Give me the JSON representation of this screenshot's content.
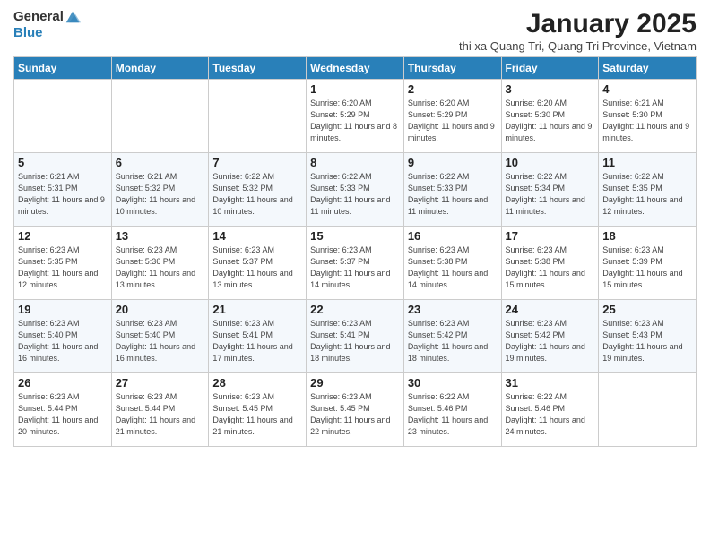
{
  "header": {
    "logo_general": "General",
    "logo_blue": "Blue",
    "title": "January 2025",
    "subtitle": "thi xa Quang Tri, Quang Tri Province, Vietnam"
  },
  "days_of_week": [
    "Sunday",
    "Monday",
    "Tuesday",
    "Wednesday",
    "Thursday",
    "Friday",
    "Saturday"
  ],
  "weeks": [
    [
      {
        "day": "",
        "info": ""
      },
      {
        "day": "",
        "info": ""
      },
      {
        "day": "",
        "info": ""
      },
      {
        "day": "1",
        "info": "Sunrise: 6:20 AM\nSunset: 5:29 PM\nDaylight: 11 hours and 8 minutes."
      },
      {
        "day": "2",
        "info": "Sunrise: 6:20 AM\nSunset: 5:29 PM\nDaylight: 11 hours and 9 minutes."
      },
      {
        "day": "3",
        "info": "Sunrise: 6:20 AM\nSunset: 5:30 PM\nDaylight: 11 hours and 9 minutes."
      },
      {
        "day": "4",
        "info": "Sunrise: 6:21 AM\nSunset: 5:30 PM\nDaylight: 11 hours and 9 minutes."
      }
    ],
    [
      {
        "day": "5",
        "info": "Sunrise: 6:21 AM\nSunset: 5:31 PM\nDaylight: 11 hours and 9 minutes."
      },
      {
        "day": "6",
        "info": "Sunrise: 6:21 AM\nSunset: 5:32 PM\nDaylight: 11 hours and 10 minutes."
      },
      {
        "day": "7",
        "info": "Sunrise: 6:22 AM\nSunset: 5:32 PM\nDaylight: 11 hours and 10 minutes."
      },
      {
        "day": "8",
        "info": "Sunrise: 6:22 AM\nSunset: 5:33 PM\nDaylight: 11 hours and 11 minutes."
      },
      {
        "day": "9",
        "info": "Sunrise: 6:22 AM\nSunset: 5:33 PM\nDaylight: 11 hours and 11 minutes."
      },
      {
        "day": "10",
        "info": "Sunrise: 6:22 AM\nSunset: 5:34 PM\nDaylight: 11 hours and 11 minutes."
      },
      {
        "day": "11",
        "info": "Sunrise: 6:22 AM\nSunset: 5:35 PM\nDaylight: 11 hours and 12 minutes."
      }
    ],
    [
      {
        "day": "12",
        "info": "Sunrise: 6:23 AM\nSunset: 5:35 PM\nDaylight: 11 hours and 12 minutes."
      },
      {
        "day": "13",
        "info": "Sunrise: 6:23 AM\nSunset: 5:36 PM\nDaylight: 11 hours and 13 minutes."
      },
      {
        "day": "14",
        "info": "Sunrise: 6:23 AM\nSunset: 5:37 PM\nDaylight: 11 hours and 13 minutes."
      },
      {
        "day": "15",
        "info": "Sunrise: 6:23 AM\nSunset: 5:37 PM\nDaylight: 11 hours and 14 minutes."
      },
      {
        "day": "16",
        "info": "Sunrise: 6:23 AM\nSunset: 5:38 PM\nDaylight: 11 hours and 14 minutes."
      },
      {
        "day": "17",
        "info": "Sunrise: 6:23 AM\nSunset: 5:38 PM\nDaylight: 11 hours and 15 minutes."
      },
      {
        "day": "18",
        "info": "Sunrise: 6:23 AM\nSunset: 5:39 PM\nDaylight: 11 hours and 15 minutes."
      }
    ],
    [
      {
        "day": "19",
        "info": "Sunrise: 6:23 AM\nSunset: 5:40 PM\nDaylight: 11 hours and 16 minutes."
      },
      {
        "day": "20",
        "info": "Sunrise: 6:23 AM\nSunset: 5:40 PM\nDaylight: 11 hours and 16 minutes."
      },
      {
        "day": "21",
        "info": "Sunrise: 6:23 AM\nSunset: 5:41 PM\nDaylight: 11 hours and 17 minutes."
      },
      {
        "day": "22",
        "info": "Sunrise: 6:23 AM\nSunset: 5:41 PM\nDaylight: 11 hours and 18 minutes."
      },
      {
        "day": "23",
        "info": "Sunrise: 6:23 AM\nSunset: 5:42 PM\nDaylight: 11 hours and 18 minutes."
      },
      {
        "day": "24",
        "info": "Sunrise: 6:23 AM\nSunset: 5:42 PM\nDaylight: 11 hours and 19 minutes."
      },
      {
        "day": "25",
        "info": "Sunrise: 6:23 AM\nSunset: 5:43 PM\nDaylight: 11 hours and 19 minutes."
      }
    ],
    [
      {
        "day": "26",
        "info": "Sunrise: 6:23 AM\nSunset: 5:44 PM\nDaylight: 11 hours and 20 minutes."
      },
      {
        "day": "27",
        "info": "Sunrise: 6:23 AM\nSunset: 5:44 PM\nDaylight: 11 hours and 21 minutes."
      },
      {
        "day": "28",
        "info": "Sunrise: 6:23 AM\nSunset: 5:45 PM\nDaylight: 11 hours and 21 minutes."
      },
      {
        "day": "29",
        "info": "Sunrise: 6:23 AM\nSunset: 5:45 PM\nDaylight: 11 hours and 22 minutes."
      },
      {
        "day": "30",
        "info": "Sunrise: 6:22 AM\nSunset: 5:46 PM\nDaylight: 11 hours and 23 minutes."
      },
      {
        "day": "31",
        "info": "Sunrise: 6:22 AM\nSunset: 5:46 PM\nDaylight: 11 hours and 24 minutes."
      },
      {
        "day": "",
        "info": ""
      }
    ]
  ]
}
